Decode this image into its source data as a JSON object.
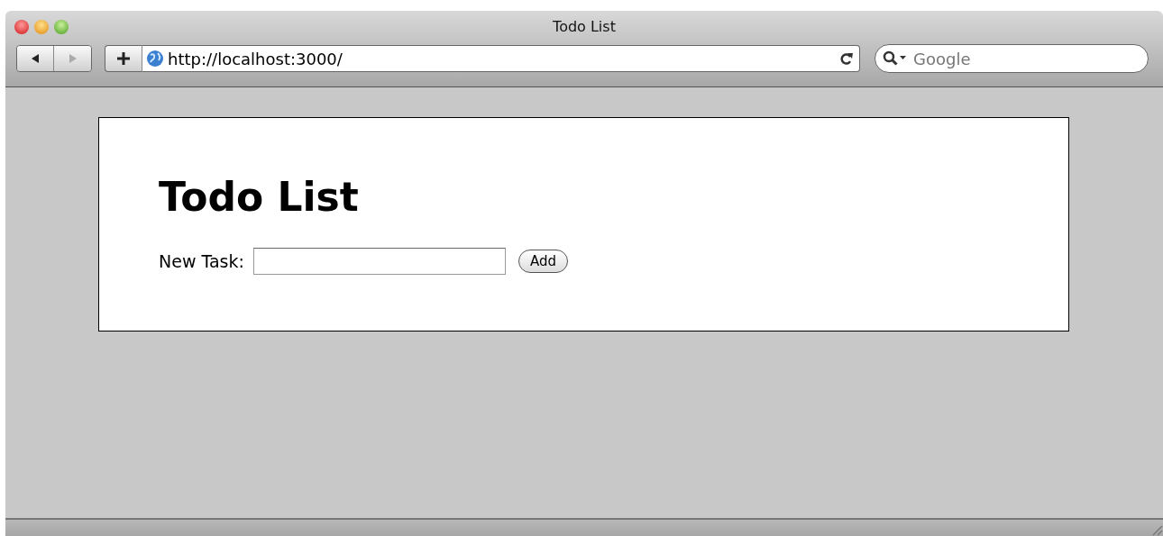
{
  "window": {
    "title": "Todo List"
  },
  "toolbar": {
    "navigation": [
      {
        "kind": "back",
        "disabled": false
      },
      {
        "kind": "forward",
        "disabled": true
      }
    ],
    "address": "http://localhost:3000/",
    "search": {
      "placeholder": "Google"
    }
  },
  "page": {
    "heading": "Todo List",
    "form": {
      "label": "New Task:",
      "button": "Add"
    }
  }
}
